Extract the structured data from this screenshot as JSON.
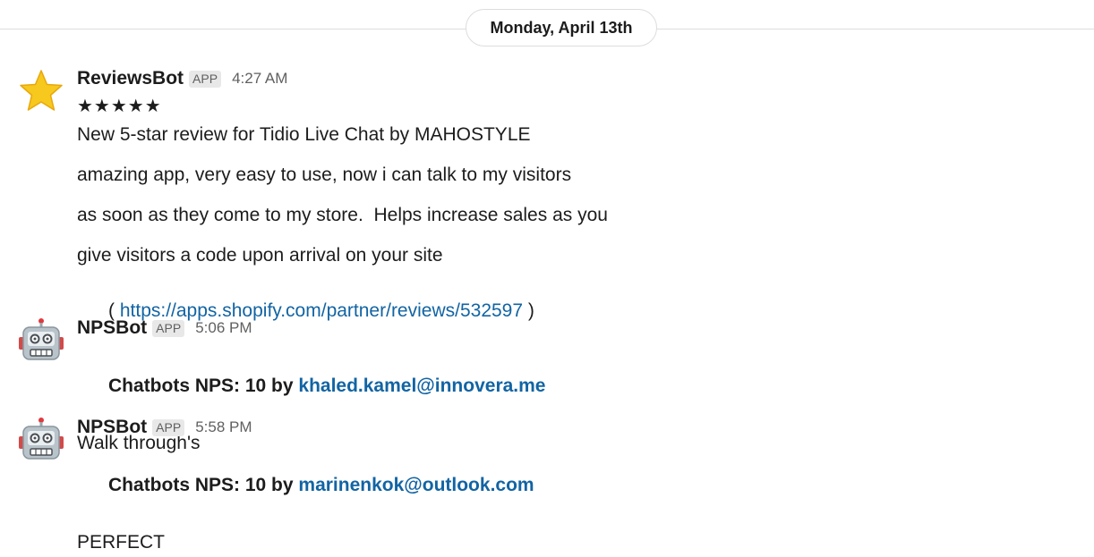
{
  "date_divider": "Monday, April 13th",
  "messages": [
    {
      "sender": "ReviewsBot",
      "badge": "APP",
      "time": "4:27 AM",
      "avatar_icon": "star-icon",
      "stars": "★★★★★",
      "lines": [
        "New 5-star review for Tidio Live Chat by MAHOSTYLE",
        "amazing app, very easy to use, now i can talk to my visitors",
        "as soon as they come to my store.  Helps increase sales as you",
        "give visitors a code upon arrival on your site"
      ],
      "link_prefix": "( ",
      "link_text": "https://apps.shopify.com/partner/reviews/532597",
      "link_suffix": " )"
    },
    {
      "sender": "NPSBot",
      "badge": "APP",
      "time": "5:06 PM",
      "avatar_icon": "robot-icon",
      "title_prefix": "Chatbots NPS: 10 by ",
      "email": "khaled.kamel@innovera.me",
      "text": "Walk through's"
    },
    {
      "sender": "NPSBot",
      "badge": "APP",
      "time": "5:58 PM",
      "avatar_icon": "robot-icon",
      "title_prefix": "Chatbots NPS: 10 by ",
      "email": "marinenkok@outlook.com",
      "text": "PERFECT"
    }
  ],
  "colors": {
    "link": "#1264a3",
    "muted": "#616061",
    "text": "#1d1c1d",
    "star": "#f5c518"
  }
}
